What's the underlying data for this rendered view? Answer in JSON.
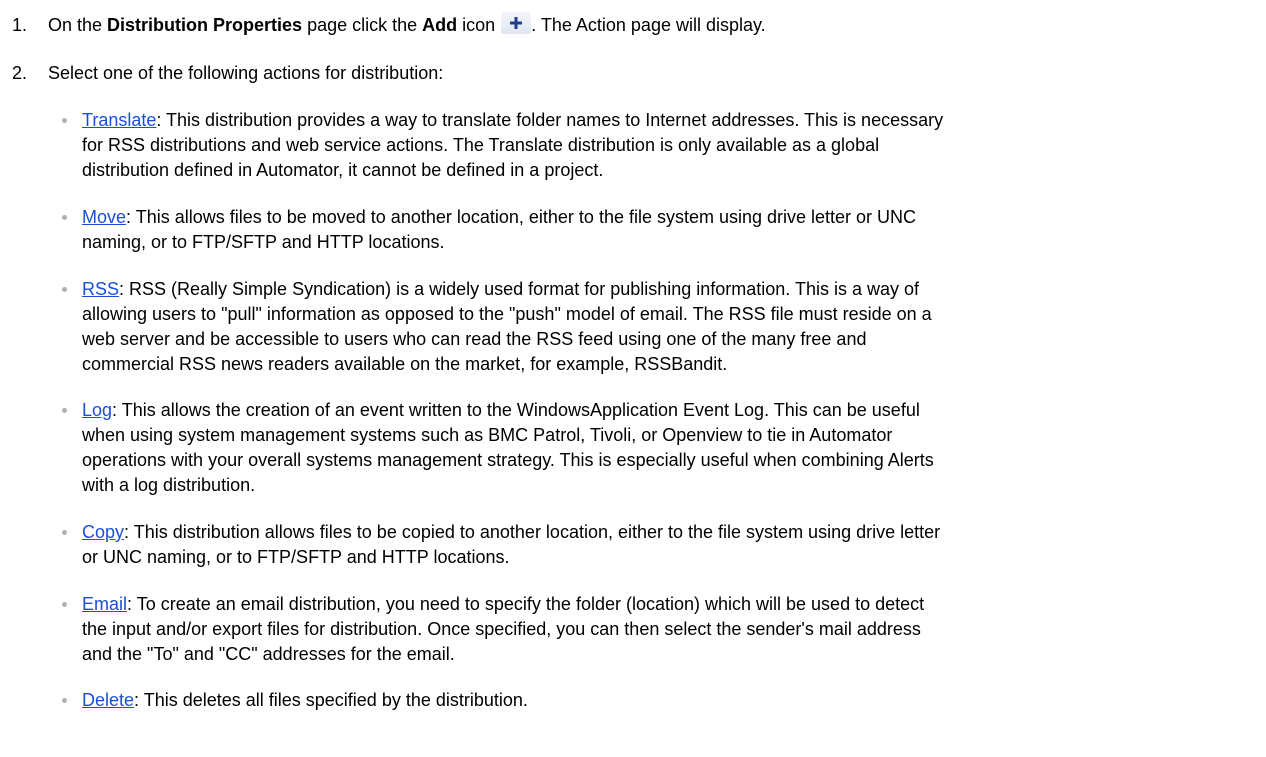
{
  "steps": [
    {
      "number": "1.",
      "before": "On the ",
      "bold1": "Distribution Properties",
      "middle": " page click the ",
      "bold2": "Add",
      "after_bold": " icon",
      "after_icon": ". The Action page will display.",
      "icon": "plus-icon"
    },
    {
      "number": "2.",
      "text": "Select one of the following actions for distribution:"
    }
  ],
  "actions": [
    {
      "link": "Translate",
      "lines": [
        ": This distribution provides a way to translate folder names to Internet addresses. This is necessary",
        "for RSS distributions and web service actions. The Translate distribution is only available as a global",
        "distribution defined in Automator, it cannot be defined in a project."
      ]
    },
    {
      "link": "Move",
      "lines": [
        ": This allows files to be moved to another location, either to the file system using drive letter or UNC",
        "naming, or to FTP/SFTP and HTTP locations."
      ]
    },
    {
      "link": "RSS",
      "lines": [
        ": RSS (Really Simple Syndication) is a widely used format for publishing information. This is a way of",
        "allowing users to \"pull\" information as opposed to the \"push\" model of email. The RSS file must reside on a",
        "web server and be accessible to users who can read the RSS feed using one of the many free and",
        "commercial RSS news readers available on the market, for example, RSSBandit."
      ]
    },
    {
      "link": "Log",
      "lines": [
        ": This allows the creation of an event written to the WindowsApplication Event Log. This can be useful",
        "when using system management systems such as BMC Patrol, Tivoli, or Openview to tie in Automator",
        "operations with your overall systems management strategy. This is especially useful when combining Alerts",
        "with a log distribution."
      ]
    },
    {
      "link": "Copy",
      "lines": [
        ": This distribution allows files to be copied to another location, either to the file system using drive letter",
        "or UNC naming, or to FTP/SFTP and HTTP locations."
      ]
    },
    {
      "link": "Email",
      "lines": [
        ": To create an email distribution, you need to specify the folder (location) which will be used to detect",
        "the input and/or export files for distribution. Once specified, you can then select the sender's mail address",
        "and the \"To\" and \"CC\" addresses for the email."
      ]
    },
    {
      "link": "Delete",
      "lines": [
        ": This deletes all files specified by the distribution."
      ]
    }
  ],
  "colors": {
    "link": "#1b4fd6",
    "icon_plus": "#1f3d8c",
    "bullet": "#b0b0b0"
  }
}
